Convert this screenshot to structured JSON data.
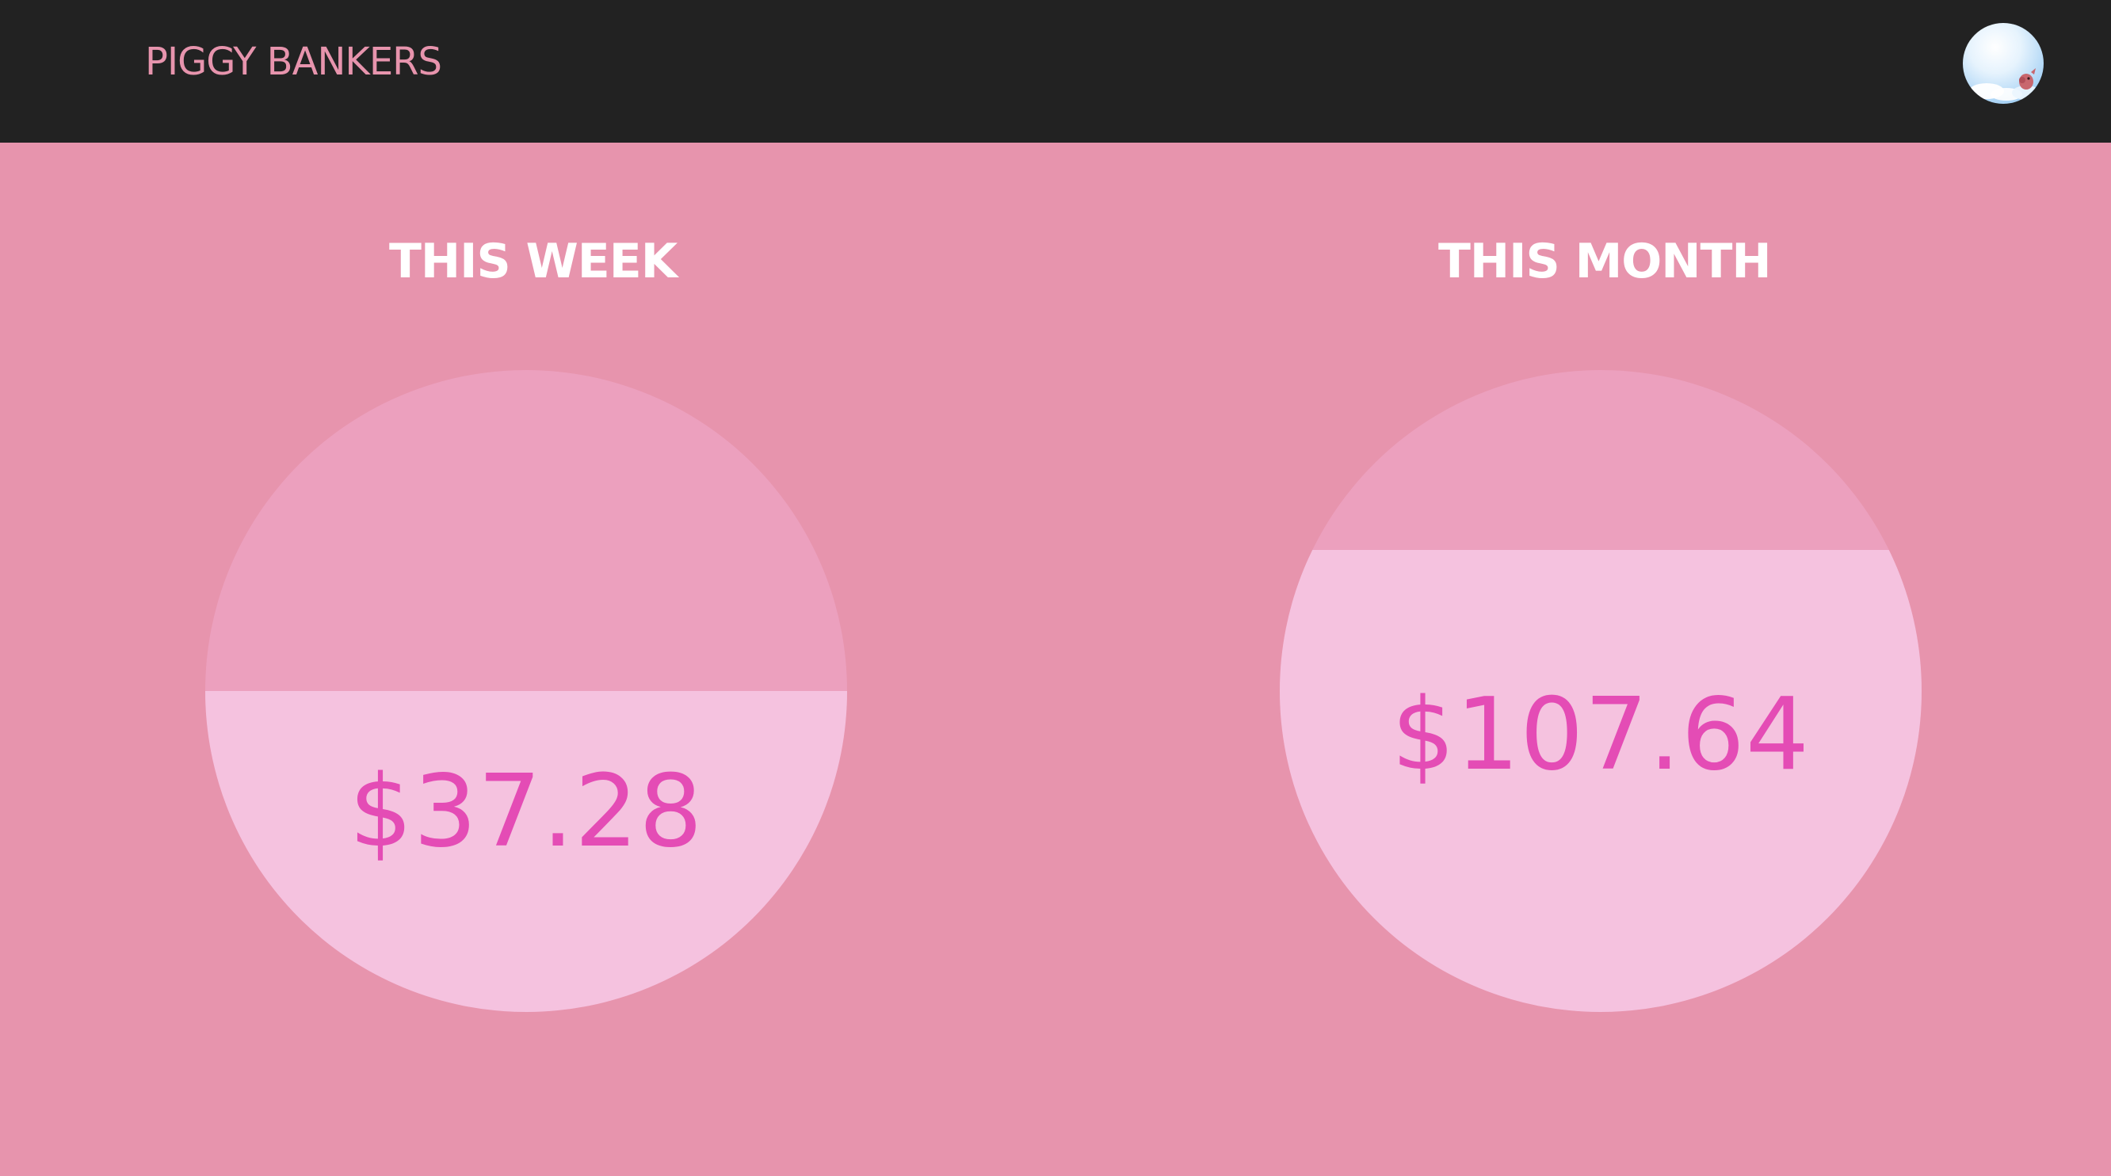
{
  "header": {
    "brand": "PIGGY BANKERS",
    "avatar_icon": "profile-avatar-sky-pig",
    "background": "#222222",
    "brand_color": "#e794ad"
  },
  "savings": {
    "week": {
      "title": "THIS WEEK",
      "amount": "$37.28",
      "fill_fraction": 0.5
    },
    "month": {
      "title": "THIS MONTH",
      "amount": "$107.64",
      "fill_fraction": 0.72
    }
  },
  "colors": {
    "page_background": "#e794ad",
    "gauge_empty": "#eca0be",
    "gauge_fill": "#f5c2df",
    "amount_text": "#e44cb5",
    "title_text": "#ffffff"
  }
}
